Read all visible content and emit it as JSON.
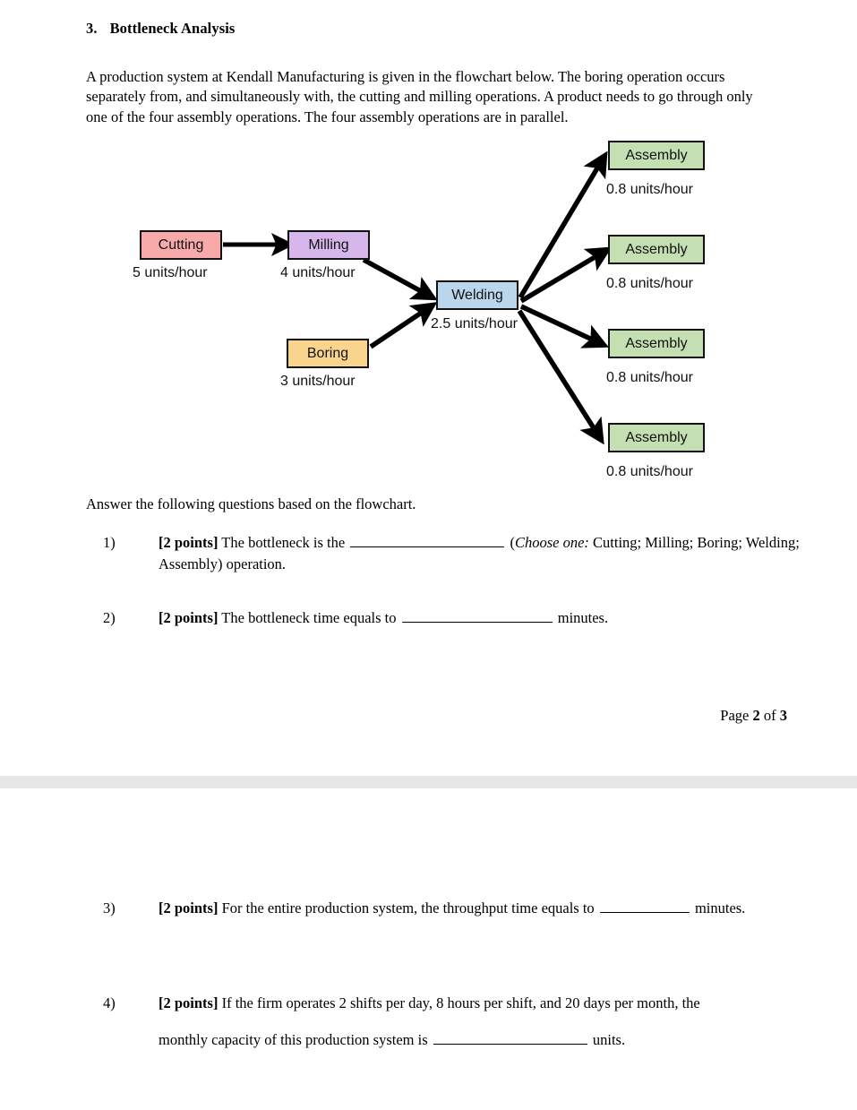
{
  "document": {
    "section_number": "3.",
    "section_title": "Bottleneck Analysis",
    "intro": "A production system at Kendall Manufacturing is given in the flowchart below. The boring operation occurs separately from, and simultaneously with, the cutting and milling operations. A product needs to go through only one of the four assembly operations. The four assembly operations are in parallel.",
    "answer_lead": "Answer the following questions based on the flowchart.",
    "footer": {
      "prefix": "Page ",
      "current": "2",
      "middle": " of ",
      "total": "3"
    }
  },
  "flowchart": {
    "nodes": [
      {
        "id": "cutting",
        "label": "Cutting",
        "rate": "5 units/hour",
        "color": "#f8a9a9"
      },
      {
        "id": "milling",
        "label": "Milling",
        "rate": "4 units/hour",
        "color": "#d7b6ec"
      },
      {
        "id": "boring",
        "label": "Boring",
        "rate": "3 units/hour",
        "color": "#f8d48c"
      },
      {
        "id": "welding",
        "label": "Welding",
        "rate": "2.5 units/hour",
        "color": "#bad6ed"
      },
      {
        "id": "assembly1",
        "label": "Assembly",
        "rate": "0.8 units/hour",
        "color": "#c4e0b2"
      },
      {
        "id": "assembly2",
        "label": "Assembly",
        "rate": "0.8 units/hour",
        "color": "#c4e0b2"
      },
      {
        "id": "assembly3",
        "label": "Assembly",
        "rate": "0.8 units/hour",
        "color": "#c4e0b2"
      },
      {
        "id": "assembly4",
        "label": "Assembly",
        "rate": "0.8 units/hour",
        "color": "#c4e0b2"
      }
    ],
    "edges": [
      {
        "from": "cutting",
        "to": "milling"
      },
      {
        "from": "milling",
        "to": "welding"
      },
      {
        "from": "boring",
        "to": "welding"
      },
      {
        "from": "welding",
        "to": "assembly1"
      },
      {
        "from": "welding",
        "to": "assembly2"
      },
      {
        "from": "welding",
        "to": "assembly3"
      },
      {
        "from": "welding",
        "to": "assembly4"
      }
    ]
  },
  "questions": [
    {
      "marker": "1)",
      "points": "[2 points]",
      "text_a": " The bottleneck is the ",
      "text_b": " (",
      "italic": "Choose one:",
      "text_c": " Cutting; Milling; Boring; Welding; Assembly) operation."
    },
    {
      "marker": "2)",
      "points": "[2 points]",
      "text_a": " The bottleneck time equals to ",
      "text_b": " minutes."
    },
    {
      "marker": "3)",
      "points": "[2 points]",
      "text_a": " For the entire production system, the throughput time equals to ",
      "text_b": " minutes."
    },
    {
      "marker": "4)",
      "points": "[2 points]",
      "text_a": " If the firm operates 2 shifts per day, 8 hours per shift, and 20 days per month, the",
      "text_b": "monthly capacity of this production system is ",
      "text_c": " units."
    }
  ]
}
